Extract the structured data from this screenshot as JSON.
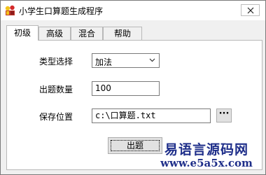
{
  "window": {
    "title": "小学生口算题生成程序",
    "close_label": "×"
  },
  "tabs": [
    {
      "label": "初级",
      "active": true
    },
    {
      "label": "高级",
      "active": false
    },
    {
      "label": "混合",
      "active": false
    },
    {
      "label": "帮助",
      "active": false
    }
  ],
  "form": {
    "type_label": "类型选择",
    "type_value": "加法",
    "count_label": "出题数量",
    "count_value": "100",
    "path_label": "保存位置",
    "path_value": "c:\\口算题.txt",
    "browse_label": "···",
    "submit_label": "出题"
  },
  "watermark": {
    "line1": "易语言源码网",
    "line2": "www.e5a5x.com"
  },
  "colors": {
    "watermark": "#1f2f8a",
    "icon_red": "#d42a2a",
    "icon_yellow": "#f2c21b"
  }
}
